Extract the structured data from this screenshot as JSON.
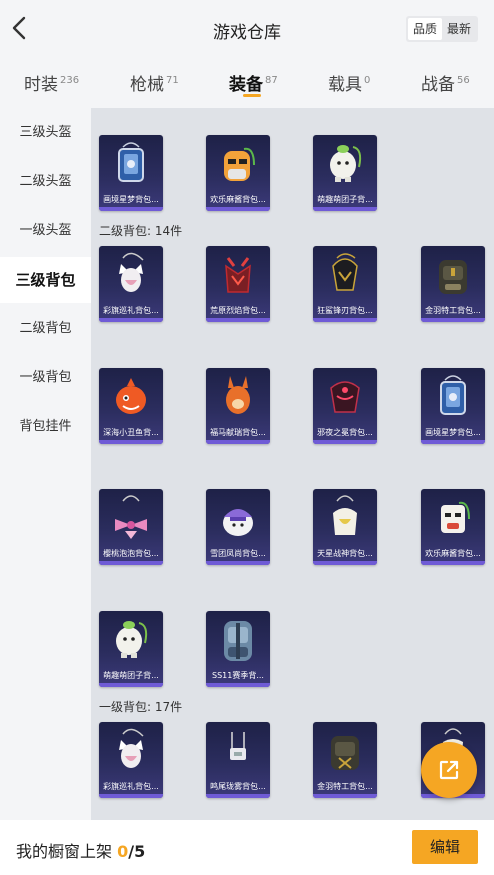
{
  "header": {
    "title": "游戏仓库",
    "sort_quality": "品质",
    "sort_newest": "最新"
  },
  "tabs": [
    {
      "label": "时装",
      "count": "236"
    },
    {
      "label": "枪械",
      "count": "71"
    },
    {
      "label": "装备",
      "count": "87"
    },
    {
      "label": "载具",
      "count": "0"
    },
    {
      "label": "战备",
      "count": "56"
    }
  ],
  "sidebar": [
    {
      "label": "三级头盔"
    },
    {
      "label": "二级头盔"
    },
    {
      "label": "一级头盔"
    },
    {
      "label": "三级背包"
    },
    {
      "label": "二级背包"
    },
    {
      "label": "一级背包"
    },
    {
      "label": "背包挂件"
    }
  ],
  "sections": {
    "level2": "二级背包: 14件",
    "level1": "一级背包: 17件"
  },
  "items_row0": [
    "画境星梦背包...",
    "欢乐麻酱背包...",
    "萌趣萌团子背..."
  ],
  "items_row1": [
    "彩旗巡礼背包...",
    "荒原烈焰背包...",
    "狂鲨锋刃背包...",
    "金羽特工背包..."
  ],
  "items_row2": [
    "深海小丑鱼背...",
    "福马献瑞背包...",
    "邪夜之冕背包...",
    "画境星梦背包..."
  ],
  "items_row3": [
    "樱桃泡泡背包...",
    "雪团凤尚背包...",
    "天星战神背包...",
    "欢乐麻酱背包..."
  ],
  "items_row4": [
    "萌趣萌团子背...",
    "SS11赛季背..."
  ],
  "items_row5": [
    "彩旗巡礼背包...",
    "鸣尾珑雾背包...",
    "金羽特工背包...",
    ""
  ],
  "footer": {
    "text": "我的橱窗上架 ",
    "count": "0",
    "total": "/5",
    "edit": "编辑"
  },
  "colors": {
    "accent": "#f5a623",
    "card_bg": "#2b2d5e",
    "rarity_bar": "#6f5bd6"
  },
  "icons": {
    "back": "back-arrow-icon",
    "share": "share-icon"
  }
}
